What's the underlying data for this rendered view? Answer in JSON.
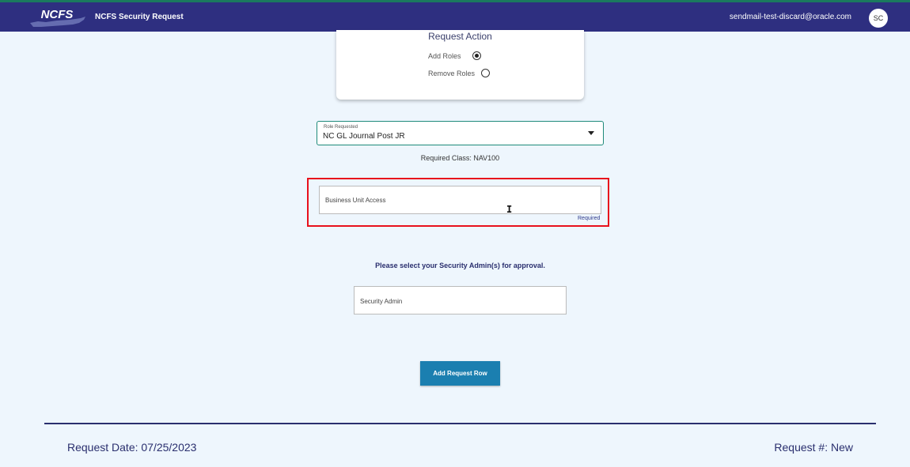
{
  "header": {
    "logo_text": "NCFS",
    "title": "NCFS Security Request",
    "user_email": "sendmail-test-discard@oracle.com",
    "avatar_initials": "SC"
  },
  "request_action": {
    "title": "Request Action",
    "options": [
      {
        "label": "Add Roles",
        "selected": true
      },
      {
        "label": "Remove Roles",
        "selected": false
      }
    ]
  },
  "role_requested": {
    "label": "Role Requested",
    "value": "NC GL Journal Post JR",
    "required_class": "Required Class: NAV100"
  },
  "business_unit": {
    "placeholder": "Business Unit Access",
    "required_note": "Required"
  },
  "approval": {
    "prompt": "Please select your Security Admin(s) for approval.",
    "security_admin_placeholder": "Security Admin"
  },
  "actions": {
    "add_request_row": "Add Request Row"
  },
  "footer": {
    "request_date": "Request Date: 07/25/2023",
    "request_number": "Request #: New"
  },
  "colors": {
    "header_bg": "#2e2f80",
    "page_bg": "#eef6fd",
    "accent_teal": "#1e8a7a",
    "button_blue": "#1b7fb0",
    "highlight_red": "#e8101c"
  }
}
